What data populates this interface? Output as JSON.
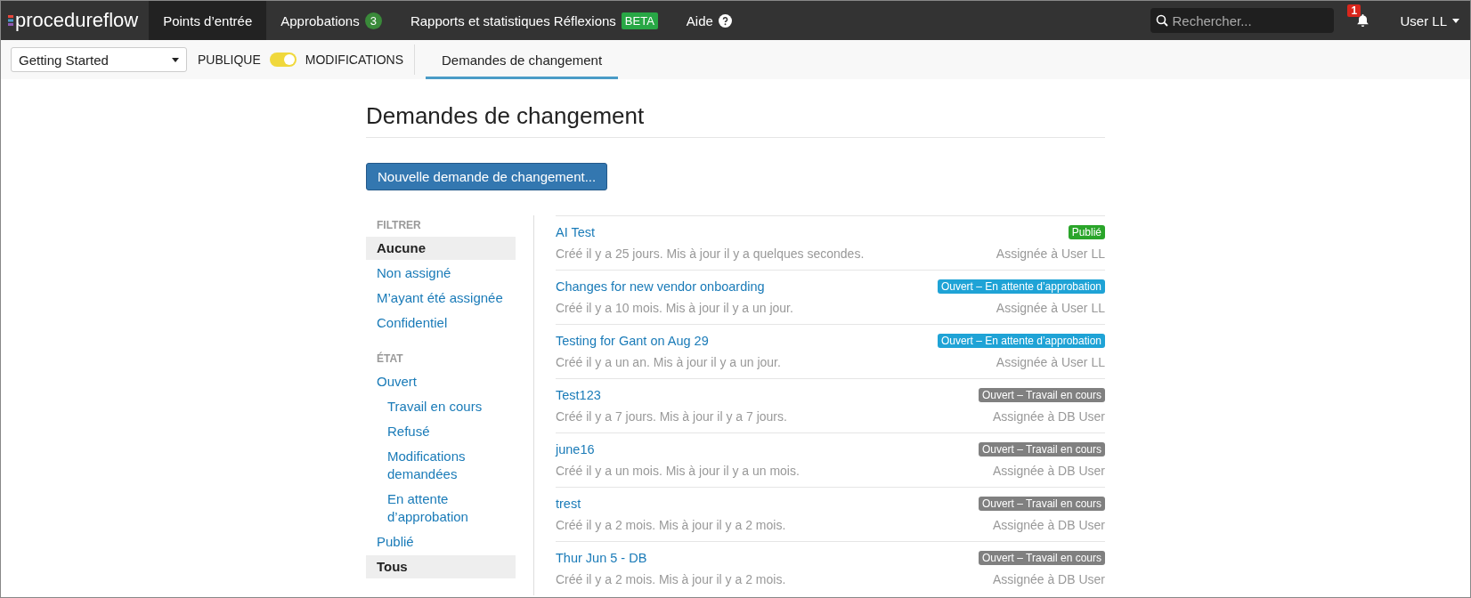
{
  "navbar": {
    "logo": "procedureflow",
    "items": [
      {
        "label": "Points d’entrée",
        "selected": true
      },
      {
        "label": "Approbations",
        "badge": "3",
        "selected": false
      },
      {
        "label": "Rapports et statistiques Réflexions",
        "tag": "BETA",
        "selected": false
      },
      {
        "label": "Aide",
        "help": true,
        "selected": false
      }
    ],
    "search": {
      "placeholder": "Rechercher..."
    },
    "notifications": "1",
    "user": "User LL"
  },
  "subbar": {
    "project": "Getting Started",
    "toggle": {
      "left": "PUBLIQUE",
      "right": "MODIFICATIONS",
      "on": true
    },
    "tabs": [
      {
        "label": "Demandes de changement",
        "selected": true
      }
    ]
  },
  "page": {
    "title": "Demandes de changement",
    "new_button": "Nouvelle demande de changement...",
    "filters": [
      {
        "heading": "FILTRER",
        "items": [
          {
            "label": "Aucune",
            "selected": true
          },
          {
            "label": "Non assigné",
            "selected": false
          },
          {
            "label": "M’ayant été assignée",
            "selected": false
          },
          {
            "label": "Confidentiel",
            "selected": false
          }
        ]
      },
      {
        "heading": "ÉTAT",
        "items": [
          {
            "label": "Ouvert",
            "selected": false,
            "children": [
              {
                "label": "Travail en cours",
                "selected": false
              },
              {
                "label": "Refusé",
                "selected": false
              },
              {
                "label": "Modifications demandées",
                "selected": false
              },
              {
                "label": "En attente d’approbation",
                "selected": false
              }
            ]
          },
          {
            "label": "Publié",
            "selected": false
          },
          {
            "label": "Tous",
            "selected": true
          }
        ]
      }
    ],
    "requests": [
      {
        "title": "AI Test",
        "meta": "Créé il y a 25 jours. Mis à jour il y a quelques secondes.",
        "status": "Publié",
        "color": "#2aa52a",
        "assignee": "Assignée à User LL"
      },
      {
        "title": "Changes for new vendor onboarding",
        "meta": "Créé il y a 10 mois. Mis à jour il y a un jour.",
        "status": "Ouvert – En attente d’approbation",
        "color": "#1fa3d6",
        "assignee": "Assignée à User LL"
      },
      {
        "title": "Testing for Gant on Aug 29",
        "meta": "Créé il y a un an. Mis à jour il y a un jour.",
        "status": "Ouvert – En attente d’approbation",
        "color": "#1fa3d6",
        "assignee": "Assignée à User LL"
      },
      {
        "title": "Test123",
        "meta": "Créé il y a 7 jours. Mis à jour il y a 7 jours.",
        "status": "Ouvert – Travail en cours",
        "color": "#808080",
        "assignee": "Assignée à DB User"
      },
      {
        "title": "june16",
        "meta": "Créé il y a un mois. Mis à jour il y a un mois.",
        "status": "Ouvert – Travail en cours",
        "color": "#808080",
        "assignee": "Assignée à DB User"
      },
      {
        "title": "trest",
        "meta": "Créé il y a 2 mois. Mis à jour il y a 2 mois.",
        "status": "Ouvert – Travail en cours",
        "color": "#808080",
        "assignee": "Assignée à DB User"
      },
      {
        "title": "Thur Jun 5 - DB",
        "meta": "Créé il y a 2 mois. Mis à jour il y a 2 mois.",
        "status": "Ouvert – Travail en cours",
        "color": "#808080",
        "assignee": "Assignée à DB User"
      }
    ]
  }
}
